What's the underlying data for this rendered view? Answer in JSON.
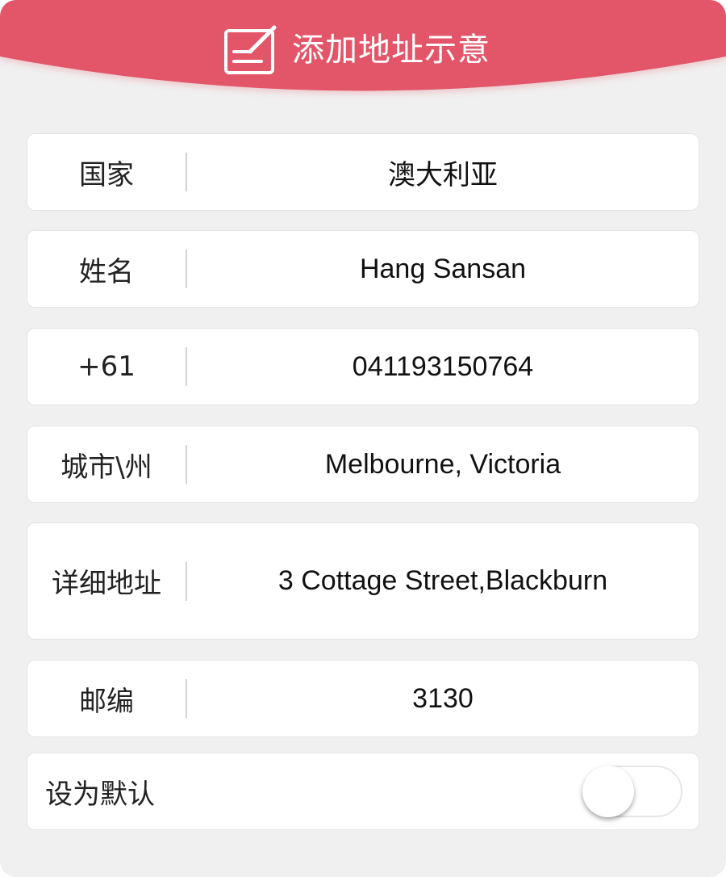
{
  "header": {
    "title": "添加地址示意",
    "icon": "edit-note-icon",
    "color": "#e35567"
  },
  "rows": [
    {
      "label": "国家",
      "value": "澳大利亚"
    },
    {
      "label": "姓名",
      "value": "Hang Sansan"
    },
    {
      "label": "+61",
      "value": "041193150764"
    },
    {
      "label": "城市\\州",
      "value": "Melbourne, Victoria"
    },
    {
      "label": "详细地址",
      "value": "3 Cottage Street,Blackburn"
    },
    {
      "label": "邮编",
      "value": "3130"
    }
  ],
  "default_setting": {
    "label": "设为默认",
    "enabled": false
  }
}
